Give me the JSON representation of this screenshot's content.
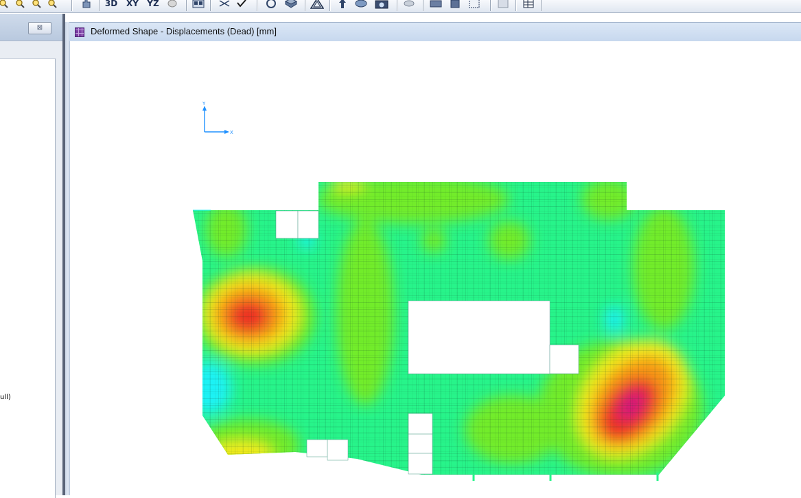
{
  "toolbar": {
    "view_3d_label": "3D",
    "view_xy_label": "XY",
    "view_yz_label": "YZ",
    "icons": [
      "zoom-in-icon",
      "zoom-out-icon",
      "zoom-window-icon",
      "zoom-previous-icon",
      "pan-icon",
      "view-3d",
      "view-xy",
      "view-yz",
      "rubber-band-icon",
      "show-all-icon",
      "select-icon",
      "check-icon",
      "rotate-icon",
      "perspective-icon",
      "warning-icon",
      "up-arrow-icon",
      "display-icon",
      "camera-icon",
      "table-icon",
      "gear-icon",
      "grid-icon",
      "spreadsheet-icon"
    ]
  },
  "left_panel": {
    "close_label": "⊠",
    "clipped_text": "ull)"
  },
  "model_window": {
    "title": "Deformed Shape - Displacements (Dead)  [mm]",
    "axis_y_label": "Y",
    "axis_x_label": "X"
  },
  "colors": {
    "contour_green": "#27f48a",
    "contour_lightgreen": "#72ec2a",
    "contour_yellow": "#f3ea1c",
    "contour_orange": "#f79a16",
    "contour_red": "#ee3320",
    "contour_magenta": "#d3137a",
    "contour_cyan": "#1ef2f5",
    "title_bar": "#c7d8ee",
    "splitter": "#5a6478"
  }
}
